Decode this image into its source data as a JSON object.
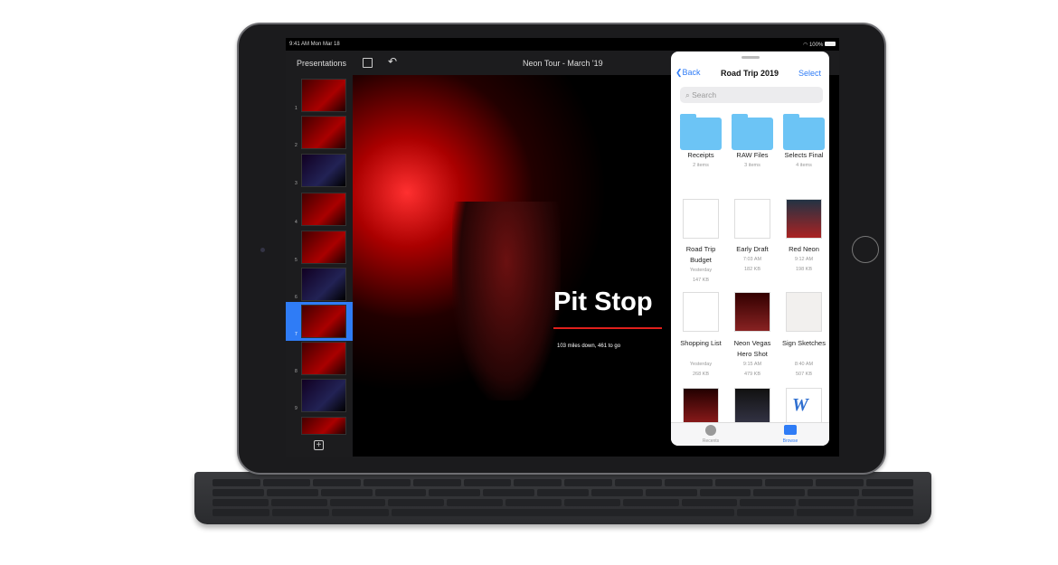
{
  "status": {
    "time": "9:41 AM  Mon Mar 18",
    "battery": "100%"
  },
  "toolbar": {
    "presentations": "Presentations",
    "title": "Neon Tour - March '19"
  },
  "slides": [
    "1",
    "2",
    "3",
    "4",
    "5",
    "6",
    "7",
    "8",
    "9"
  ],
  "selected_slide": "7",
  "slide": {
    "title": "Pit Stop",
    "subtitle": "103 miles down, 461 to go",
    "accent": "#e0201c"
  },
  "files": {
    "back": "Back",
    "title": "Road Trip 2019",
    "select": "Select",
    "search_placeholder": "Search",
    "folders": [
      {
        "name": "Receipts",
        "meta": "2 items"
      },
      {
        "name": "RAW Files",
        "meta": "3 items"
      },
      {
        "name": "Selects Final",
        "meta": "4 items"
      }
    ],
    "docs": [
      {
        "name": "Road Trip Budget",
        "meta": [
          "Yesterday",
          "147 KB"
        ]
      },
      {
        "name": "Early Draft",
        "meta": [
          "7:03 AM",
          "182 KB"
        ]
      },
      {
        "name": "Red Neon",
        "meta": [
          "9:12 AM",
          "198 KB"
        ]
      },
      {
        "name": "Shopping List",
        "meta": [
          "Yesterday",
          "268 KB"
        ]
      },
      {
        "name": "Neon Vegas Hero Shot",
        "meta": [
          "9:15 AM",
          "479 KB"
        ]
      },
      {
        "name": "Sign Sketches",
        "meta": [
          "8:40 AM",
          "507 KB"
        ]
      }
    ],
    "tabs": {
      "recents": "Recents",
      "browse": "Browse"
    },
    "accent": "#2f7cf6"
  }
}
